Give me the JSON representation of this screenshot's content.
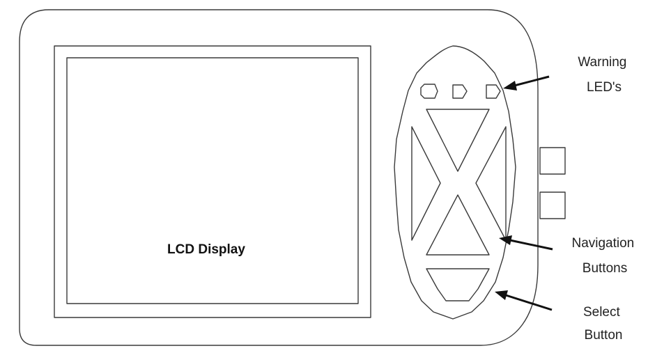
{
  "lcd": {
    "label": "LCD Display"
  },
  "callouts": {
    "warning_leds": [
      "Warning",
      "LED's"
    ],
    "navigation_buttons": [
      "Navigation",
      "Buttons"
    ],
    "select_button": [
      "Select",
      "Button"
    ]
  },
  "colors": {
    "line": "#3a3a3a",
    "arrow": "#111111",
    "text": "#222222",
    "background": "#ffffff"
  }
}
